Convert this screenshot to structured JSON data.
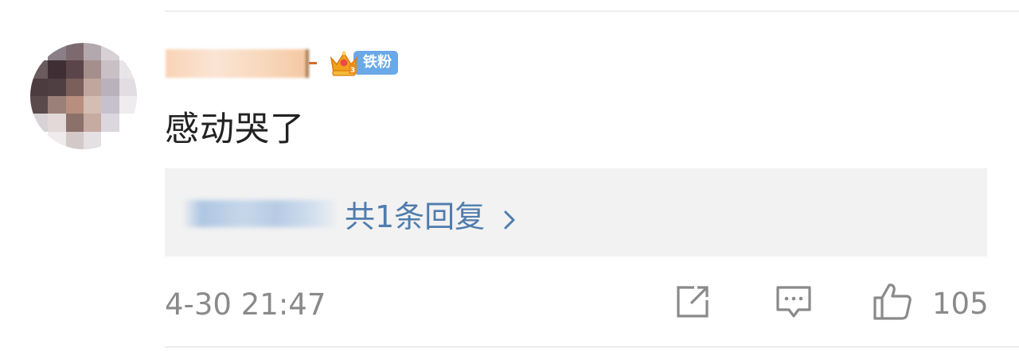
{
  "comment": {
    "text": "感动哭了",
    "badge_label": "铁粉",
    "timestamp": "4-30 21:47",
    "like_count": "105"
  },
  "replies": {
    "summary": "共1条回复"
  },
  "icons": {
    "badge": "crown-icon",
    "share": "share-icon",
    "reply": "comment-icon",
    "like": "thumbs-up-icon",
    "more": "chevron-right-icon"
  },
  "colors": {
    "link_blue": "#4f7cad",
    "badge_blue": "#6aa8e8",
    "meta_gray": "#8a8a8a",
    "reply_bg": "#f2f2f2"
  }
}
